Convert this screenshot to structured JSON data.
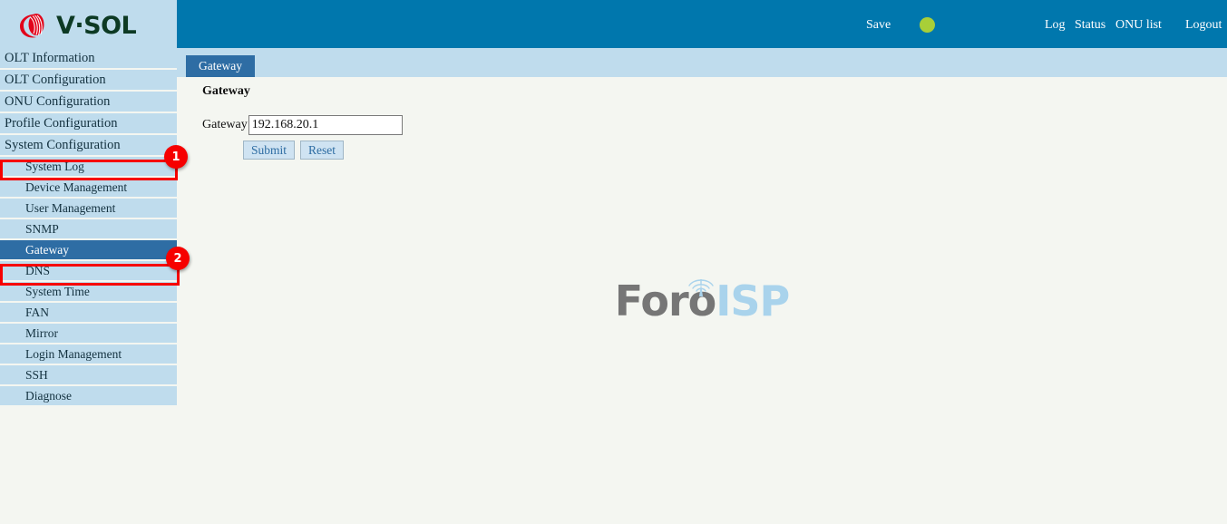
{
  "brand": {
    "logo_text": "V·SOL",
    "logo_icon": "vsol-swirl-logo",
    "logo_red": "#e2041b",
    "logo_green": "#0d3a24"
  },
  "header": {
    "background": "#0077ad",
    "save_label": "Save",
    "status_indicator": {
      "name": "status-dot",
      "color": "#a8cf38"
    },
    "links": [
      {
        "label": "Log"
      },
      {
        "label": "Status"
      },
      {
        "label": "ONU list"
      },
      {
        "label": "Logout"
      }
    ],
    "log_label": "Log",
    "status_label": "Status",
    "onu_list_label": "ONU list",
    "logout_label": "Logout"
  },
  "tabbar": {
    "background": "#bfdced",
    "active_tab": "Gateway",
    "active_tab_color": "#2e6da4"
  },
  "sidebar": {
    "background": "#bfdced",
    "active_color": "#2e6da4",
    "menu": [
      {
        "label": "OLT Information",
        "level": "main",
        "active": false
      },
      {
        "label": "OLT Configuration",
        "level": "main",
        "active": false
      },
      {
        "label": "ONU Configuration",
        "level": "main",
        "active": false
      },
      {
        "label": "Profile Configuration",
        "level": "main",
        "active": false
      },
      {
        "label": "System Configuration",
        "level": "main",
        "active": false
      },
      {
        "label": "System Log",
        "level": "sub",
        "active": false
      },
      {
        "label": "Device Management",
        "level": "sub",
        "active": false
      },
      {
        "label": "User Management",
        "level": "sub",
        "active": false
      },
      {
        "label": "SNMP",
        "level": "sub",
        "active": false
      },
      {
        "label": "Gateway",
        "level": "sub",
        "active": true
      },
      {
        "label": "DNS",
        "level": "sub",
        "active": false
      },
      {
        "label": "System Time",
        "level": "sub",
        "active": false
      },
      {
        "label": "FAN",
        "level": "sub",
        "active": false
      },
      {
        "label": "Mirror",
        "level": "sub",
        "active": false
      },
      {
        "label": "Login Management",
        "level": "sub",
        "active": false
      },
      {
        "label": "SSH",
        "level": "sub",
        "active": false
      },
      {
        "label": "Diagnose",
        "level": "sub",
        "active": false
      }
    ]
  },
  "content": {
    "background": "#f4f6f1",
    "panel_title": "Gateway",
    "gateway_label": "Gateway",
    "gateway_value": "192.168.20.1",
    "gateway_placeholder": "",
    "submit_label": "Submit",
    "reset_label": "Reset"
  },
  "watermark": {
    "text_primary": "Foro",
    "text_secondary": "ISP",
    "primary_color": "#767676",
    "secondary_color": "#a9d3ec",
    "icon": "antenna-tower-icon"
  },
  "annotations": [
    {
      "badge": "1",
      "target": "System Configuration"
    },
    {
      "badge": "2",
      "target": "Gateway"
    }
  ],
  "annotation_one": "1",
  "annotation_two": "2"
}
